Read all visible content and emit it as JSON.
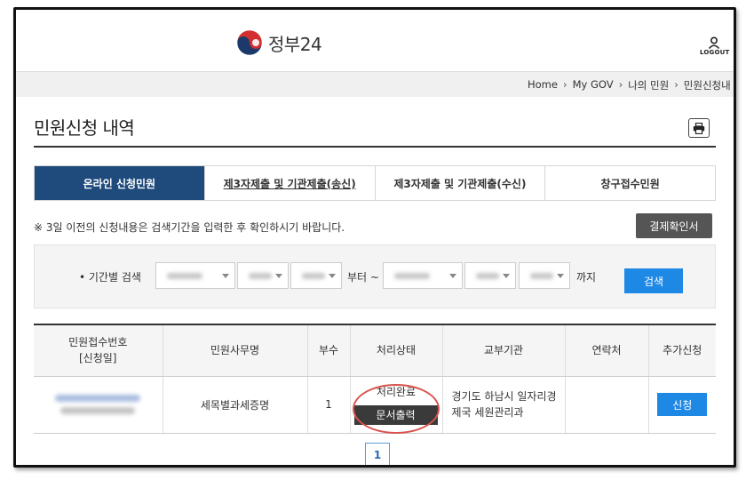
{
  "header": {
    "logo_text": "정부24",
    "logout_label": "LOGOUT"
  },
  "breadcrumb": [
    "Home",
    "My GOV",
    "나의 민원",
    "민원신청내"
  ],
  "page_title": "민원신청 내역",
  "tabs": [
    {
      "label": "온라인 신청민원",
      "active": true
    },
    {
      "label": "제3자제출 및 기관제출(송신)",
      "active": false
    },
    {
      "label": "제3자제출 및 기관제출(수신)",
      "active": false
    },
    {
      "label": "창구접수민원",
      "active": false
    }
  ],
  "notice": "※ 3일 이전의 신청내용은 검색기간을 입력한 후 확인하시기 바랍니다.",
  "payment_button": "결제확인서",
  "search": {
    "label": "• 기간별 검색",
    "from_word": "부터 ~",
    "until_word": "까지",
    "button": "검색"
  },
  "table": {
    "headers": [
      "민원접수번호\n[신청일]",
      "민원사무명",
      "부수",
      "처리상태",
      "교부기관",
      "연락처",
      "추가신청"
    ],
    "rows": [
      {
        "service": "세목별과세증명",
        "copies": "1",
        "status": "처리완료",
        "doc_button": "문서출력",
        "agency": "경기도 하남시 일자리경제국 세원관리과",
        "contact": "",
        "apply_button": "신청"
      }
    ]
  },
  "pagination": {
    "current": "1"
  },
  "colors": {
    "tab_active": "#1e4a7c",
    "search_button": "#1e88e5",
    "highlight_circle": "#d9534f"
  }
}
